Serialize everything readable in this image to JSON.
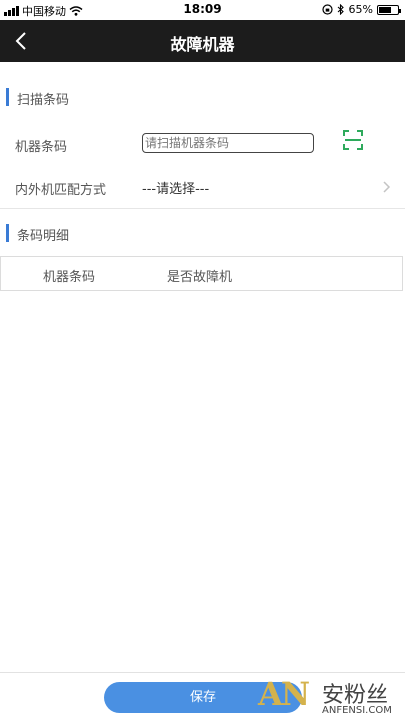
{
  "status_bar": {
    "carrier": "中国移动",
    "time": "18:09",
    "battery_percent": "65%",
    "battery_level": 0.65,
    "icons": [
      "signal-icon",
      "wifi-icon",
      "orientation-lock-icon",
      "bluetooth-icon",
      "battery-icon"
    ]
  },
  "nav": {
    "title": "故障机器",
    "back_icon": "chevron-left-icon"
  },
  "scan_section": {
    "title": "扫描条码",
    "barcode_label": "机器条码",
    "barcode_placeholder": "请扫描机器条码",
    "barcode_value": "",
    "scan_icon": "scan-icon",
    "match_label": "内外机匹配方式",
    "match_value": "---请选择---"
  },
  "detail_section": {
    "title": "条码明细",
    "columns": [
      "机器条码",
      "是否故障机"
    ]
  },
  "footer": {
    "save_label": "保存"
  },
  "watermark": {
    "letters": "AN",
    "brand": "安粉丝",
    "domain": "ANFENSI.COM"
  },
  "colors": {
    "nav_bg": "#1c1c1c",
    "accent": "#3a7bd5",
    "button": "#4a90e2",
    "scan_icon": "#2eaa5c"
  }
}
